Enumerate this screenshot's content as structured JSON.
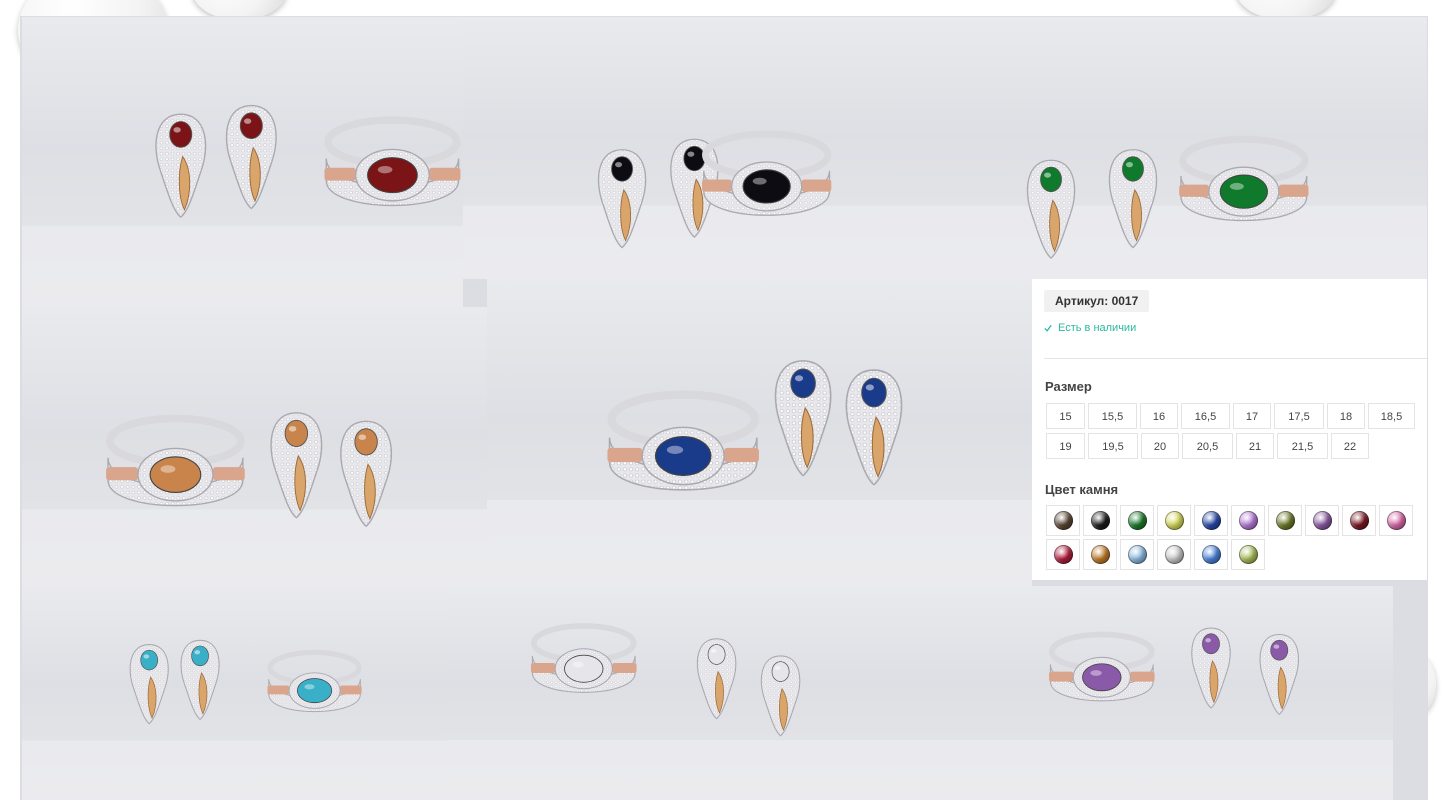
{
  "product": {
    "article_label": "Артикул: 0017",
    "stock_label": "Есть в наличии",
    "size_heading": "Размер",
    "sizes": [
      [
        "15",
        "15,5",
        "16",
        "16,5",
        "17",
        "17,5",
        "18",
        "18,5"
      ],
      [
        "19",
        "19,5",
        "20",
        "20,5",
        "21",
        "21,5",
        "22"
      ]
    ],
    "stone_heading": "Цвет камня",
    "stone_colors": [
      [
        "#5a4632",
        "#1c1c1c",
        "#1c7a2c",
        "#d6d85a",
        "#2849a8",
        "#b37ad6",
        "#6c7a2a",
        "#8a5aa0",
        "#7a1822",
        "#d86aa8"
      ],
      [
        "#b01c3c",
        "#c07a28",
        "#8ab8e0",
        "#c8c8c8",
        "#4a82d8",
        "#a8bc5a"
      ]
    ]
  },
  "photos": [
    {
      "name": "photo-garnet-set",
      "stone": "#7a1416"
    },
    {
      "name": "photo-black-set",
      "stone": "#0c0c12"
    },
    {
      "name": "photo-emerald-set",
      "stone": "#0f7a2c"
    },
    {
      "name": "photo-citrine-set",
      "stone": "#c8844a"
    },
    {
      "name": "photo-sapphire-set",
      "stone": "#1a3a8a"
    },
    {
      "name": "photo-aquamarine-set",
      "stone": "#3ab0c8"
    },
    {
      "name": "photo-white-set",
      "stone": "#e6e6ea"
    },
    {
      "name": "photo-amethyst-set",
      "stone": "#8a5aa8"
    }
  ]
}
